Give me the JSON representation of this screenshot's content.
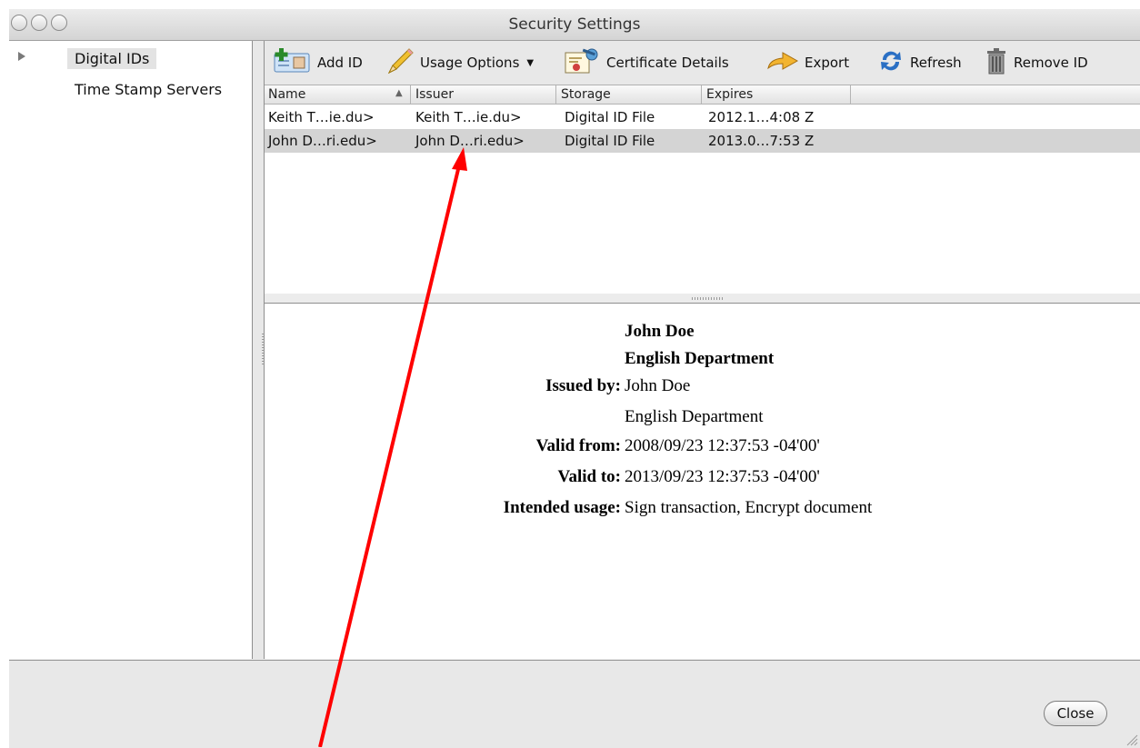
{
  "window": {
    "title": "Security Settings"
  },
  "sidebar": {
    "items": [
      {
        "label": "Digital IDs"
      },
      {
        "label": "Time Stamp Servers"
      }
    ]
  },
  "toolbar": {
    "add_id": "Add ID",
    "usage_options": "Usage Options",
    "certificate_details": "Certificate Details",
    "export": "Export",
    "refresh": "Refresh",
    "remove_id": "Remove ID"
  },
  "table": {
    "columns": [
      "Name",
      "Issuer",
      "Storage",
      "Expires"
    ],
    "rows": [
      {
        "name": "Keith T…ie.du>",
        "issuer": "Keith T…ie.du>",
        "storage": "Digital ID File",
        "expires": "2012.1…4:08 Z"
      },
      {
        "name": "John D…ri.edu>",
        "issuer": "John D…ri.edu>",
        "storage": "Digital ID File",
        "expires": "2013.0…7:53 Z"
      }
    ]
  },
  "details": {
    "name": "John Doe",
    "department": "English Department",
    "issued_by_label": "Issued by:",
    "issued_by_name": "John Doe",
    "issued_by_dept": "English Department",
    "valid_from_label": "Valid from:",
    "valid_from": "2008/09/23 12:37:53 -04'00'",
    "valid_to_label": "Valid to:",
    "valid_to": "2013/09/23 12:37:53 -04'00'",
    "usage_label": "Intended usage:",
    "usage": "Sign transaction, Encrypt document"
  },
  "footer": {
    "close": "Close"
  },
  "colors": {
    "annotation_arrow": "#ff0000",
    "selected_row": "#d4d4d4"
  }
}
